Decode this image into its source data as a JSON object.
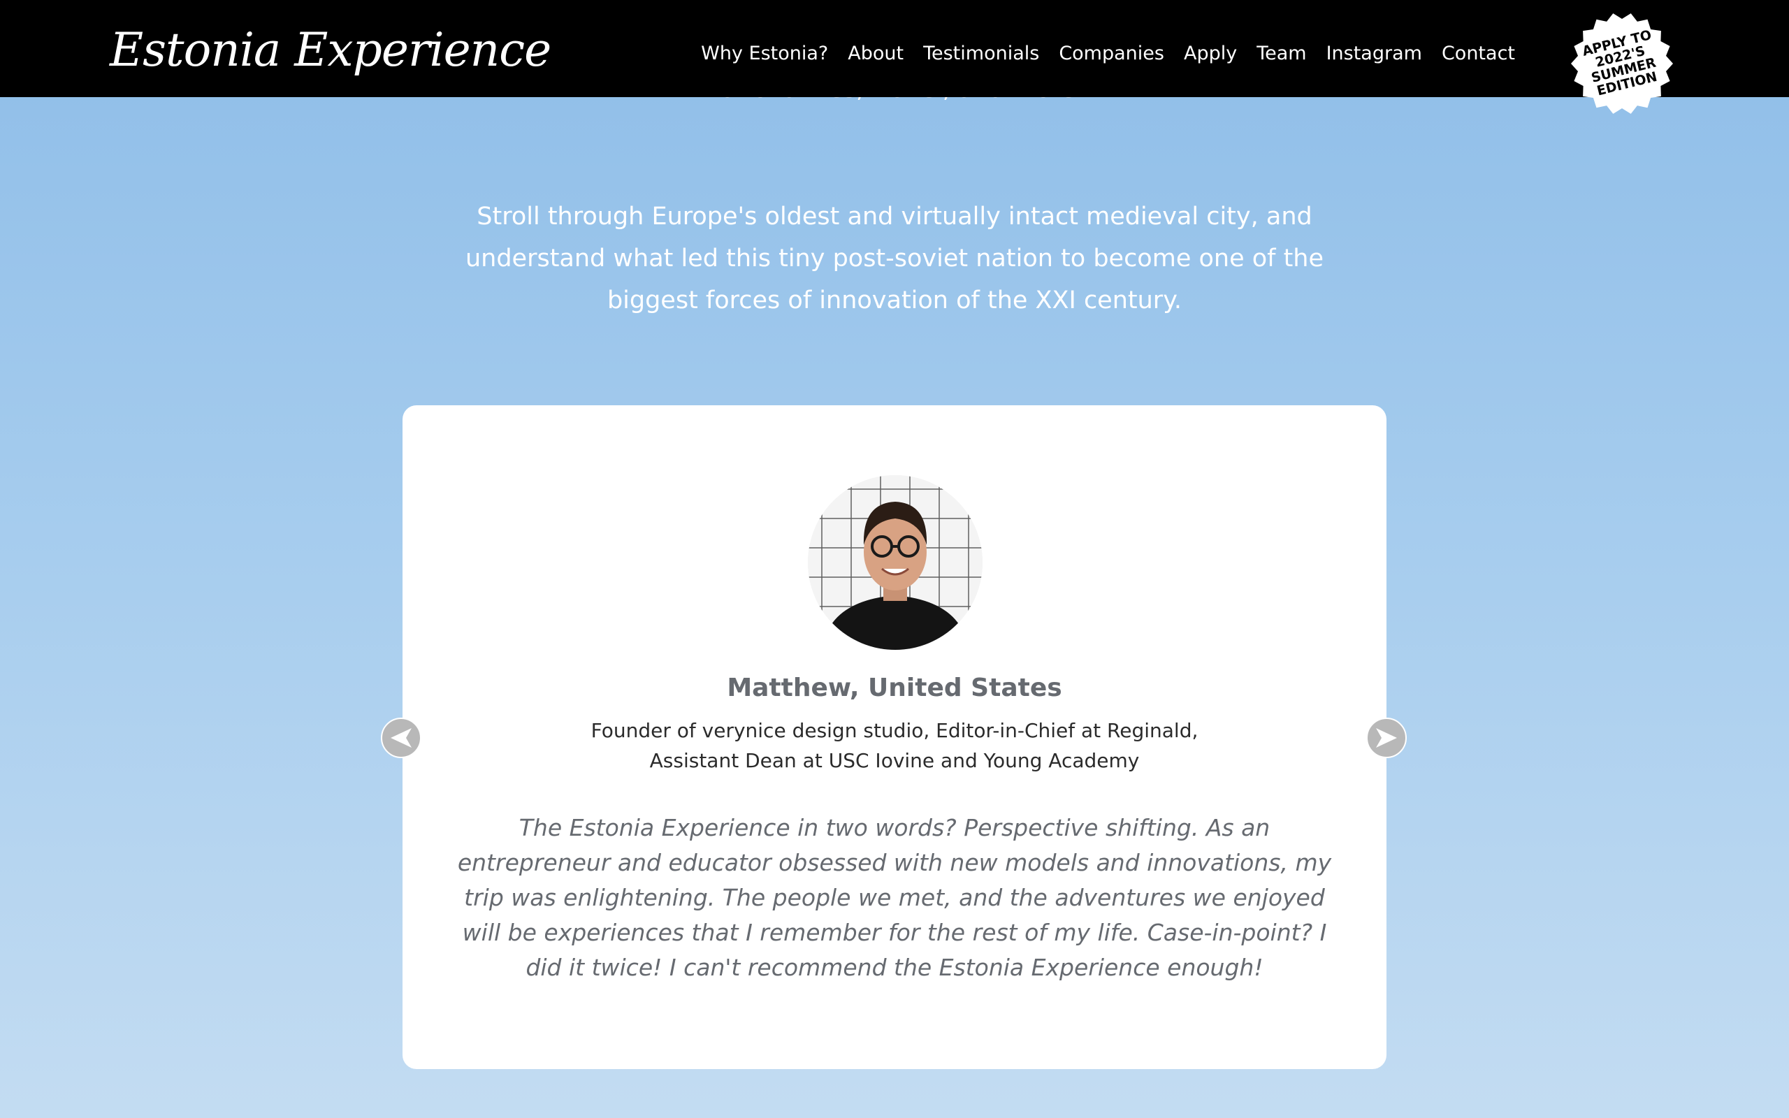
{
  "brand": {
    "name": "Estonia Experience"
  },
  "nav": {
    "items": [
      {
        "label": "Why Estonia?"
      },
      {
        "label": "About"
      },
      {
        "label": "Testimonials"
      },
      {
        "label": "Companies"
      },
      {
        "label": "Apply"
      },
      {
        "label": "Team"
      },
      {
        "label": "Instagram"
      },
      {
        "label": "Contact"
      }
    ],
    "badge": {
      "text": "APPLY TO\n2022'S\nSUMMER\nEDITION"
    }
  },
  "intro": {
    "paragraph_1_visible": "nationalities, travel, and more.",
    "paragraph_2": "Stroll through Europe's oldest and virtually intact medieval city, and understand what led this tiny post-soviet nation to become one of the biggest forces of innovation of the XXI century."
  },
  "testimonial": {
    "name": "Matthew, United States",
    "role": "Founder of verynice design studio, Editor-in-Chief at Reginald, Assistant Dean at USC Iovine and Young Academy",
    "quote": "The Estonia Experience in two words? Perspective shifting. As an entrepreneur and educator obsessed with new models and innovations, my trip was enlightening. The people we met, and the adventures we enjoyed will be experiences that I remember for the rest of my life. Case-in-point? I did it twice! I can't recommend the Estonia Experience enough!",
    "avatar_icon": "person-photo"
  },
  "carousel": {
    "prev_icon": "arrow-left-icon",
    "next_icon": "arrow-right-icon"
  },
  "colors": {
    "nav_background": "#000000",
    "sky_top": "#8ebde8",
    "sky_bottom": "#c3dcf2",
    "card_background": "#ffffff",
    "name_text": "#666a70",
    "arrow_fill": "#b8b8b8"
  }
}
